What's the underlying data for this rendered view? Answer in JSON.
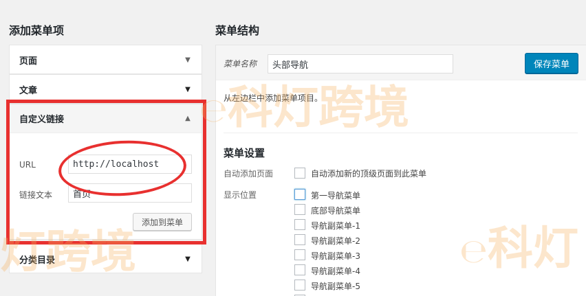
{
  "left": {
    "heading": "添加菜单项",
    "sections": {
      "pages": "页面",
      "posts": "文章",
      "custom_links": "自定义链接",
      "categories": "分类目录"
    },
    "custom_link_form": {
      "url_label": "URL",
      "url_value": "http://localhost",
      "text_label": "链接文本",
      "text_value": "首页",
      "add_button": "添加到菜单"
    }
  },
  "right": {
    "heading": "菜单结构",
    "menu_name_label": "菜单名称",
    "menu_name_value": "头部导航",
    "save_button": "保存菜单",
    "hint": "从左边栏中添加菜单项目。",
    "settings_heading": "菜单设置",
    "auto_add_label": "自动添加页面",
    "auto_add_option": "自动添加新的顶级页面到此菜单",
    "location_label": "显示位置",
    "locations": [
      "第一导航菜单",
      "底部导航菜单",
      "导航副菜单-1",
      "导航副菜单-2",
      "导航副菜单-3",
      "导航副菜单-4",
      "导航副菜单-5"
    ]
  },
  "watermark": {
    "text_top": "科灯跨境",
    "text_left": "灯跨境",
    "text_right": "科灯"
  },
  "colors": {
    "primary": "#0085ba",
    "annotation_red": "#e8302f",
    "watermark": "#f6b260"
  }
}
